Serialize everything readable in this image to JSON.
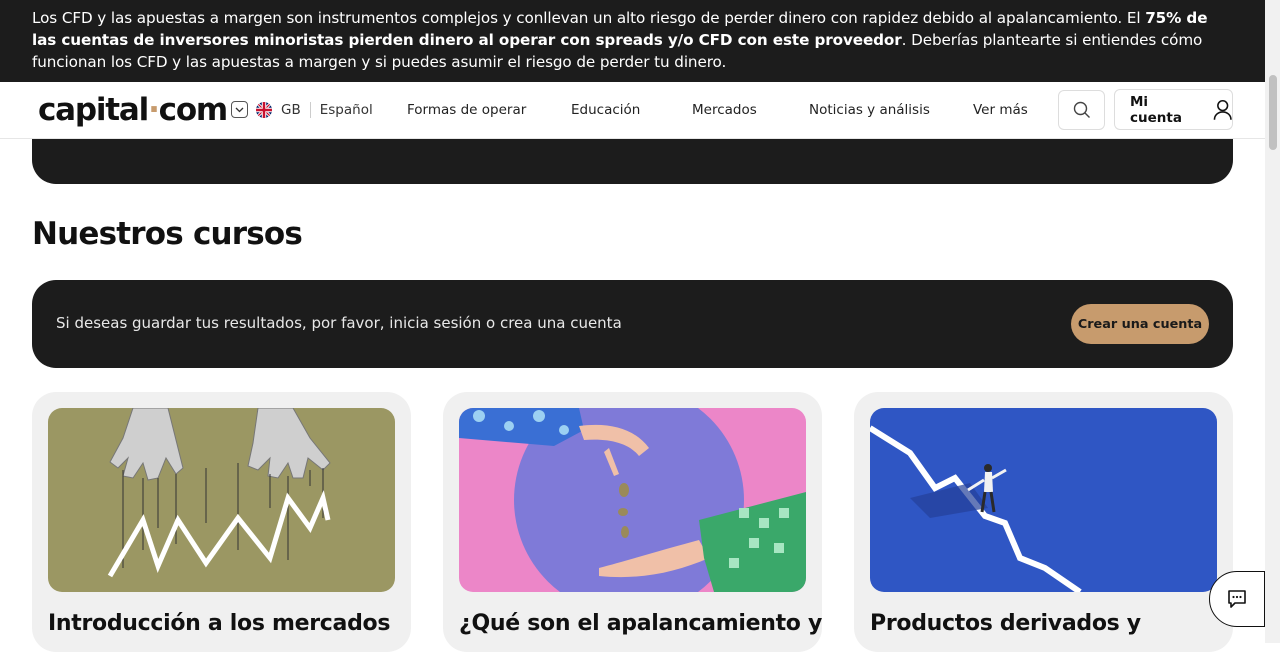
{
  "risk_banner": {
    "part1": "Los CFD y las apuestas a margen son instrumentos complejos y conllevan un alto riesgo de perder dinero con rapidez debido al apalancamiento. El ",
    "bold": "75% de las cuentas de inversores minoristas pierden dinero al operar con spreads y/o CFD con este proveedor",
    "part2": ". Deberías plantearte si entiendes cómo funcionan los CFD y las apuestas a margen y si puedes asumir el riesgo de perder tu dinero."
  },
  "header": {
    "logo_left": "capital",
    "logo_dot": "·",
    "logo_right": "com",
    "region": "GB",
    "language": "Español",
    "nav": [
      "Formas de operar",
      "Educación",
      "Mercados",
      "Noticias y análisis",
      "Ver más"
    ],
    "account_label": "Mi cuenta"
  },
  "main": {
    "section_title": "Nuestros cursos",
    "login_prompt": "Si deseas guardar tus resultados, por favor, inicia sesión o crea una cuenta",
    "create_account_label": "Crear una cuenta",
    "courses": [
      {
        "title": "Introducción a los mercados",
        "image": "puppet-hands-chart-image"
      },
      {
        "title": "¿Qué son el apalancamiento y",
        "image": "hands-coins-image"
      },
      {
        "title": "Productos derivados y",
        "image": "person-on-falling-line-image"
      }
    ]
  },
  "colors": {
    "dark": "#1c1c1c",
    "accent": "#c79b6d",
    "card_bg": "#f0f0f0"
  },
  "icons": [
    "chevron-down-icon",
    "uk-flag-icon",
    "search-icon",
    "user-icon",
    "chat-icon"
  ]
}
